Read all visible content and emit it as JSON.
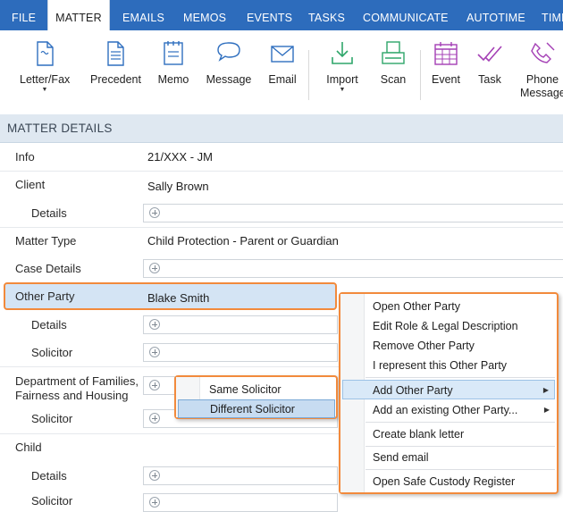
{
  "tabs": [
    "FILE",
    "MATTER",
    "EMAILS",
    "MEMOS",
    "EVENTS",
    "TASKS",
    "COMMUNICATE",
    "AUTOTIME",
    "TIME"
  ],
  "active_tab": "MATTER",
  "ribbon": {
    "letter_fax": "Letter/Fax",
    "precedent": "Precedent",
    "memo": "Memo",
    "message": "Message",
    "email": "Email",
    "import": "Import",
    "scan": "Scan",
    "event": "Event",
    "task": "Task",
    "phone_message": "Phone Message"
  },
  "section_title": "MATTER DETAILS",
  "fields": {
    "info_label": "Info",
    "info_value": "21/XXX - JM",
    "client_label": "Client",
    "client_value": "Sally Brown",
    "client_details_label": "Details",
    "matter_type_label": "Matter Type",
    "matter_type_value": "Child Protection - Parent or Guardian",
    "case_details_label": "Case Details",
    "other_party_label": "Other Party",
    "other_party_value": "Blake Smith",
    "other_party_details_label": "Details",
    "other_party_solicitor_label": "Solicitor",
    "department_label_line1": "Department of Families,",
    "department_label_line2": "Fairness and Housing",
    "department_solicitor_label": "Solicitor",
    "child_label": "Child",
    "child_details_label": "Details",
    "child_solicitor_label": "Solicitor"
  },
  "context_menu": {
    "open": "Open Other Party",
    "edit_role": "Edit Role & Legal Description",
    "remove": "Remove Other Party",
    "represent": "I represent this Other Party",
    "add": "Add Other Party",
    "add_existing": "Add an existing Other Party...",
    "blank_letter": "Create blank letter",
    "send_email": "Send email",
    "safe_custody": "Open Safe Custody Register"
  },
  "submenu": {
    "same": "Same Solicitor",
    "different": "Different Solicitor"
  },
  "colors": {
    "ribbon_blue": "#2d6cbc",
    "highlight_orange": "#f28a3c",
    "selection_blue": "#d4e4f4",
    "icon_blue": "#2f6fbf",
    "icon_green": "#2ea66a",
    "icon_purple": "#a43fb5"
  }
}
